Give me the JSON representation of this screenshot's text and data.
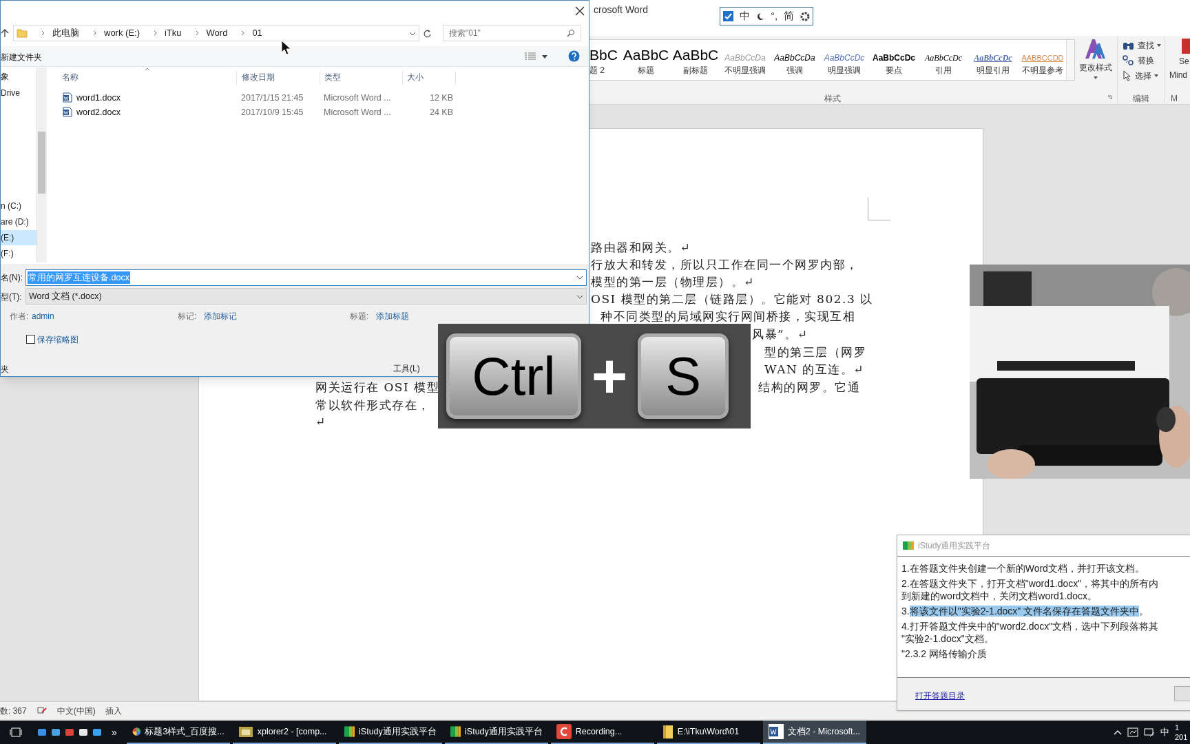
{
  "word": {
    "title": "crosoft Word",
    "ime_bar": {
      "checked": true,
      "items": [
        "中",
        "°,",
        "简"
      ]
    },
    "styles": [
      {
        "kind": "heading",
        "preview": "BbC",
        "label": "题 2"
      },
      {
        "kind": "title",
        "preview": "AaBbC",
        "label": "标题"
      },
      {
        "kind": "subtitle",
        "preview": "AaBbC",
        "label": "副标题"
      },
      {
        "kind": "subtle_emphasis",
        "preview": "AaBbCcDa",
        "label": "不明显强调"
      },
      {
        "kind": "emphasis",
        "preview": "AaBbCcDa",
        "label": "强调"
      },
      {
        "kind": "intense_emphasis",
        "preview": "AaBbCcDc",
        "label": "明显强调"
      },
      {
        "kind": "strong",
        "preview": "AaBbCcDc",
        "label": "要点"
      },
      {
        "kind": "quote",
        "preview": "AaBbCcDc",
        "label": "引用"
      },
      {
        "kind": "intense_quote",
        "preview": "AaBbCcDc",
        "label": "明显引用"
      },
      {
        "kind": "subtle_reference",
        "preview": "AABBCCDD",
        "label": "不明显参考"
      }
    ],
    "styles_group": "样式",
    "change_styles": "更改样式",
    "editing": [
      {
        "label": "查找",
        "dropdown": true
      },
      {
        "label": "替换",
        "dropdown": false
      },
      {
        "label": "选择",
        "dropdown": true
      }
    ],
    "editing_group": "编辑",
    "cut_texts": [
      "Se",
      "Mind",
      "M"
    ],
    "document_lines": [
      [
        "路由器和网关。↵"
      ],
      [
        "行放大和转发，所以只工作在同一个网罗内部，"
      ],
      [
        "模型的第一层（物理层）。↵"
      ],
      [
        "OSI 模型的第二层（链路层）。它能对 802.3 以"
      ],
      [
        "种不同类型的局域网实行网间桥接，实现互相"
      ],
      [
        "风暴”。↵"
      ],
      [
        "型的第三层（网罗"
      ],
      [
        "WAN 的互连。↵"
      ],
      [
        "网关运行在 OSI 模型",
        "结构的网罗。它通"
      ],
      [
        "常以软件形式存在，"
      ],
      [
        "↵"
      ]
    ],
    "status_bar": {
      "words": "数: 367",
      "language": "中文(中国)",
      "mode": "插入"
    }
  },
  "dialog": {
    "breadcrumbs": [
      "此电脑",
      "work (E:)",
      "iTku",
      "Word",
      "01"
    ],
    "search": {
      "placeholder": "搜索\"01\""
    },
    "new_folder": "新建文件夹",
    "nav_items": [
      {
        "label": "象",
        "selected": false
      },
      {
        "label": "Drive",
        "selected": false
      },
      {
        "label": "n (C:)",
        "selected": false
      },
      {
        "label": "are (D:)",
        "selected": false
      },
      {
        "label": "(E:)",
        "selected": true
      },
      {
        "label": "(F:)",
        "selected": false
      }
    ],
    "columns": [
      "名称",
      "修改日期",
      "类型",
      "大小"
    ],
    "files": [
      {
        "name": "word1.docx",
        "date": "2017/1/15 21:45",
        "type": "Microsoft Word ...",
        "size": "12 KB"
      },
      {
        "name": "word2.docx",
        "date": "2017/10/9 15:45",
        "type": "Microsoft Word ...",
        "size": "24 KB"
      }
    ],
    "filename_label": "名(N):",
    "filename": "常用的网罗互连设备.docx",
    "filetype_label": "型(T):",
    "filetype": "Word 文档 (*.docx)",
    "meta": [
      {
        "label": "作者:",
        "value": "admin"
      },
      {
        "label": "标记:",
        "value": "添加标记"
      },
      {
        "label": "标题:",
        "value": "添加标题"
      }
    ],
    "thumbnail": {
      "label": "保存缩略图",
      "checked": false
    },
    "hide_folders": "夹",
    "tools": "工具(L)"
  },
  "keys_overlay": {
    "keys": [
      "Ctrl",
      "S"
    ],
    "plus": "+"
  },
  "istudy": {
    "title": "iStudy通用实践平台",
    "lines": [
      {
        "kind": "plain",
        "text": "1.在答题文件夹创建一个新的Word文档，并打开该文档。"
      },
      {
        "kind": "plain",
        "text": "2.在答题文件夹下，打开文档\"word1.docx\"，将其中的所有内"
      },
      {
        "kind": "cont",
        "text": "到新建的word文档中，关闭文档word1.docx。"
      },
      {
        "kind": "highlight",
        "before": "3.",
        "text": "将该文件以\"实验2-1.docx\" 文件名保存在答题文件夹中",
        "after": "。"
      },
      {
        "kind": "plain",
        "text": "4.打开答题文件夹中的\"word2.docx\"文档，选中下列段落将其"
      },
      {
        "kind": "cont",
        "text": "\"实验2-1.docx\"文档。"
      },
      {
        "kind": "plain",
        "text": "\"2.3.2 网络传输介质"
      }
    ],
    "footer_link": "打开答题目录"
  },
  "taskbar": {
    "items": [
      {
        "label": "标题3样式_百度搜...",
        "kind": "browser",
        "selected": false
      },
      {
        "label": "xplorer2 - [comp...",
        "kind": "explorer",
        "selected": false
      },
      {
        "label": "iStudy通用实践平台",
        "kind": "istudy",
        "selected": false
      },
      {
        "label": "iStudy通用实践平台",
        "kind": "istudy",
        "selected": false
      },
      {
        "label": "Recording...",
        "kind": "recorder",
        "selected": false
      },
      {
        "label": "E:\\iTku\\Word\\01",
        "kind": "folder",
        "selected": false
      },
      {
        "label": "文档2 - Microsoft...",
        "kind": "word",
        "selected": true
      }
    ],
    "more": "»",
    "ime": "中",
    "clock": [
      "1",
      "201"
    ]
  }
}
